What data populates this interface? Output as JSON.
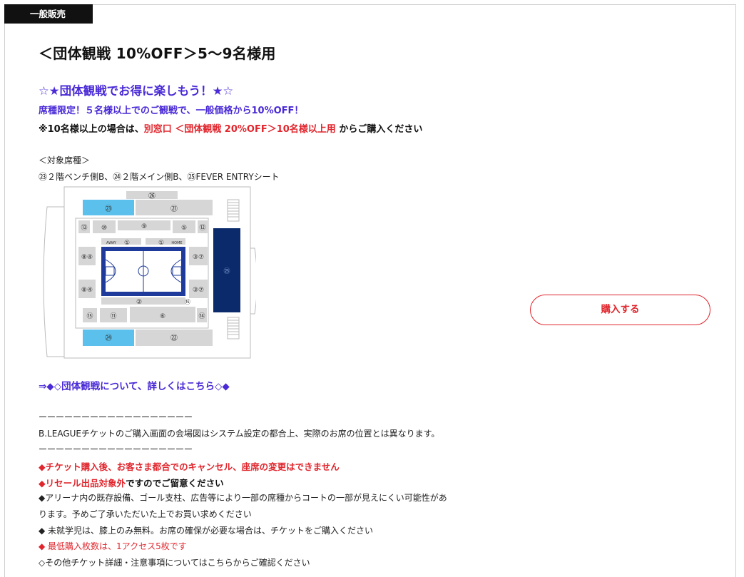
{
  "badge": "一般販売",
  "title": "＜団体観戦 10%OFF＞5〜9名様用",
  "headline": "☆★団体観戦でお得に楽しもう！★☆",
  "promo": "席種限定！５名様以上でのご観戦で、一般価格から10%OFF！",
  "note": {
    "prefix": "※10名様以上の場合は、",
    "link": "別窓口 ＜団体観戦 20%OFF＞10名様以上用",
    "suffix": " からご購入ください"
  },
  "target_label": "＜対象席種＞",
  "target_seats": "㉓２階ベンチ側B、㉔２階メイン側B、㉕FEVER ENTRYシート",
  "map": {
    "sec_23": "㉓",
    "sec_21": "㉑",
    "sec_26": "㉖",
    "sec_13": "⑬",
    "sec_10": "⑩",
    "sec_9": "⑨",
    "sec_5": "⑤",
    "sec_12": "⑫",
    "sec_1a": "①",
    "sec_1b": "①",
    "away": "AWAY",
    "home": "HOME",
    "sec_84a": "⑧④",
    "sec_84b": "⑧④",
    "sec_37a": "③⑦",
    "sec_37b": "③⑦",
    "sec_2": "②",
    "sec_16": "⑯",
    "sec_25": "㉕",
    "sec_15": "⑮",
    "sec_11": "⑪",
    "sec_6": "⑥",
    "sec_14": "⑭",
    "sec_24": "㉔",
    "sec_22": "㉒",
    "colors": {
      "highlight_blue": "#5bc0eb",
      "navy": "#0b2a6b",
      "court_blue": "#1e3a9a",
      "gray": "#d6d6d6"
    }
  },
  "group_link": "⇒◆◇団体観戦について、詳しくはこちら◇◆",
  "divider": "ーーーーーーーーーーーーーーーーーー",
  "layout_note": "B.LEAGUEチケットのご購入画面の会場図はシステム設定の都合上、実際のお席の位置とは異なります。",
  "cancel_notice": "◆チケット購入後、お客さま都合でのキャンセル、座席の変更はできません",
  "resale_red": "◆リセール出品対象外",
  "resale_rest": "ですのでご留意ください",
  "arena_line1": "◆アリーナ内の既存設備、ゴール支柱、広告等により一部の席種からコートの一部が見えにくい可能性があ",
  "arena_line2": "ります。予めご了承いただいた上でお買い求めください",
  "children": "◆ 未就学児は、膝上のみ無料。お席の確保が必要な場合は、チケットをご購入ください",
  "min_purchase": "◆ 最低購入枚数は、1アクセス5枚です",
  "other_info": "◇その他チケット詳細・注意事項についてはこちらからご確認ください",
  "purchase_button": "購入する"
}
